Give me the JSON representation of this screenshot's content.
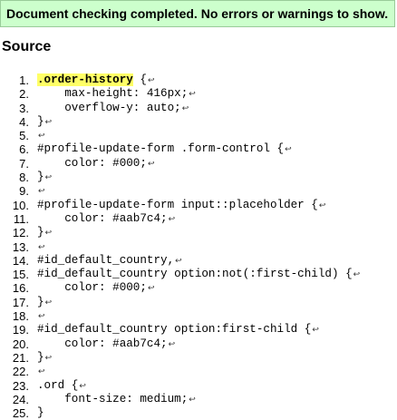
{
  "status": {
    "message": "Document checking completed. No errors or warnings to show.",
    "color": "#ccffcc"
  },
  "source": {
    "heading": "Source",
    "eol_marker": "↩",
    "highlight_color": "#ffff66",
    "lines": [
      {
        "num": "1.",
        "indent": "",
        "highlight": ".order-history",
        "text": " {",
        "eol": true
      },
      {
        "num": "2.",
        "indent": "    ",
        "highlight": "",
        "text": "max-height: 416px;",
        "eol": true
      },
      {
        "num": "3.",
        "indent": "    ",
        "highlight": "",
        "text": "overflow-y: auto;",
        "eol": true
      },
      {
        "num": "4.",
        "indent": "",
        "highlight": "",
        "text": "}",
        "eol": true
      },
      {
        "num": "5.",
        "indent": "",
        "highlight": "",
        "text": "",
        "eol": true
      },
      {
        "num": "6.",
        "indent": "",
        "highlight": "",
        "text": "#profile-update-form .form-control {",
        "eol": true
      },
      {
        "num": "7.",
        "indent": "    ",
        "highlight": "",
        "text": "color: #000;",
        "eol": true
      },
      {
        "num": "8.",
        "indent": "",
        "highlight": "",
        "text": "}",
        "eol": true
      },
      {
        "num": "9.",
        "indent": "",
        "highlight": "",
        "text": "",
        "eol": true
      },
      {
        "num": "10.",
        "indent": "",
        "highlight": "",
        "text": "#profile-update-form input::placeholder {",
        "eol": true
      },
      {
        "num": "11.",
        "indent": "    ",
        "highlight": "",
        "text": "color: #aab7c4;",
        "eol": true
      },
      {
        "num": "12.",
        "indent": "",
        "highlight": "",
        "text": "}",
        "eol": true
      },
      {
        "num": "13.",
        "indent": "",
        "highlight": "",
        "text": "",
        "eol": true
      },
      {
        "num": "14.",
        "indent": "",
        "highlight": "",
        "text": "#id_default_country,",
        "eol": true
      },
      {
        "num": "15.",
        "indent": "",
        "highlight": "",
        "text": "#id_default_country option:not(:first-child) {",
        "eol": true
      },
      {
        "num": "16.",
        "indent": "    ",
        "highlight": "",
        "text": "color: #000;",
        "eol": true
      },
      {
        "num": "17.",
        "indent": "",
        "highlight": "",
        "text": "}",
        "eol": true
      },
      {
        "num": "18.",
        "indent": "",
        "highlight": "",
        "text": "",
        "eol": true
      },
      {
        "num": "19.",
        "indent": "",
        "highlight": "",
        "text": "#id_default_country option:first-child {",
        "eol": true
      },
      {
        "num": "20.",
        "indent": "    ",
        "highlight": "",
        "text": "color: #aab7c4;",
        "eol": true
      },
      {
        "num": "21.",
        "indent": "",
        "highlight": "",
        "text": "}",
        "eol": true
      },
      {
        "num": "22.",
        "indent": "",
        "highlight": "",
        "text": "",
        "eol": true
      },
      {
        "num": "23.",
        "indent": "",
        "highlight": "",
        "text": ".ord {",
        "eol": true
      },
      {
        "num": "24.",
        "indent": "    ",
        "highlight": "",
        "text": "font-size: medium;",
        "eol": true
      },
      {
        "num": "25.",
        "indent": "",
        "highlight": "",
        "text": "}",
        "eol": false
      }
    ]
  }
}
